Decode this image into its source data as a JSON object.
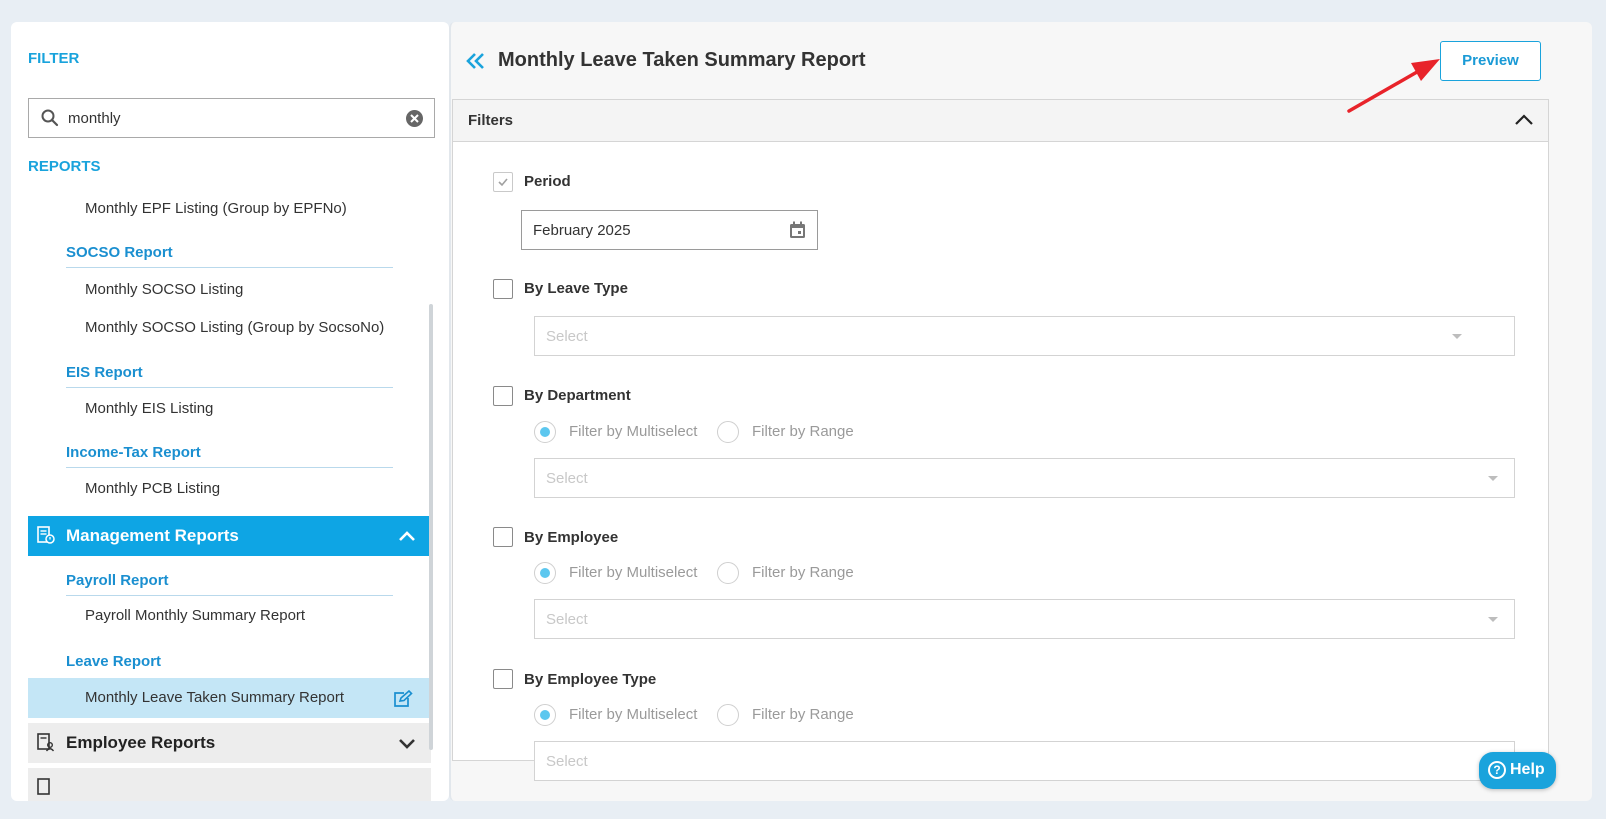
{
  "sidebar": {
    "filter_heading": "FILTER",
    "search": {
      "value": "monthly",
      "placeholder": ""
    },
    "reports_heading": "REPORTS",
    "items_top": [
      "Monthly EPF Listing (Group by EPFNo)"
    ],
    "socso": {
      "title": "SOCSO Report",
      "items": [
        "Monthly SOCSO Listing",
        "Monthly SOCSO Listing (Group by SocsoNo)"
      ]
    },
    "eis": {
      "title": "EIS Report",
      "items": [
        "Monthly EIS Listing"
      ]
    },
    "income_tax": {
      "title": "Income-Tax Report",
      "items": [
        "Monthly PCB Listing"
      ]
    },
    "management": {
      "title": "Management Reports"
    },
    "payroll": {
      "title": "Payroll Report",
      "items": [
        "Payroll Monthly Summary Report"
      ]
    },
    "leave": {
      "title": "Leave Report",
      "active_item": "Monthly Leave Taken Summary Report"
    },
    "employee": {
      "title": "Employee Reports"
    }
  },
  "main": {
    "title": "Monthly Leave Taken Summary Report",
    "preview_label": "Preview",
    "filters_title": "Filters",
    "period": {
      "label": "Period",
      "checked": true,
      "value": "February 2025"
    },
    "leave_type": {
      "label": "By Leave Type",
      "select_placeholder": "Select"
    },
    "department": {
      "label": "By Department",
      "radio_multi": "Filter by Multiselect",
      "radio_range": "Filter by Range",
      "select_placeholder": "Select"
    },
    "employee": {
      "label": "By Employee",
      "radio_multi": "Filter by Multiselect",
      "radio_range": "Filter by Range",
      "select_placeholder": "Select"
    },
    "employee_type": {
      "label": "By Employee Type",
      "radio_multi": "Filter by Multiselect",
      "radio_range": "Filter by Range",
      "select_placeholder": "Select"
    }
  },
  "help_label": "Help",
  "colors": {
    "accent": "#1aa3dc",
    "active_row": "#c4e6f6",
    "annotation_arrow": "#e8232a"
  }
}
